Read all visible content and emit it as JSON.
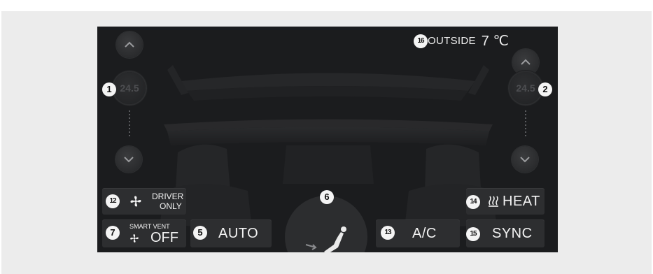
{
  "outside": {
    "label": "OUTSIDE",
    "value": "7 ℃"
  },
  "temperature": {
    "left": "24.5",
    "right": "24.5"
  },
  "buttons": {
    "driver_only": {
      "line1": "DRIVER",
      "line2": "ONLY"
    },
    "smart_vent": {
      "line1": "SMART VENT",
      "line2": "OFF"
    },
    "auto": "AUTO",
    "ac": "A/C",
    "heat": "HEAT",
    "sync": "SYNC"
  },
  "callouts": [
    "1",
    "2",
    "5",
    "6",
    "7",
    "12",
    "13",
    "14",
    "15",
    "16"
  ],
  "icons": {
    "left_up": "chevron-up-icon",
    "left_down": "chevron-down-icon",
    "right_up": "chevron-up-icon",
    "right_down": "chevron-down-icon",
    "fan": "fan-icon",
    "seat_heat": "seat-heat-icon",
    "airflow": "airflow-mode-icon"
  }
}
